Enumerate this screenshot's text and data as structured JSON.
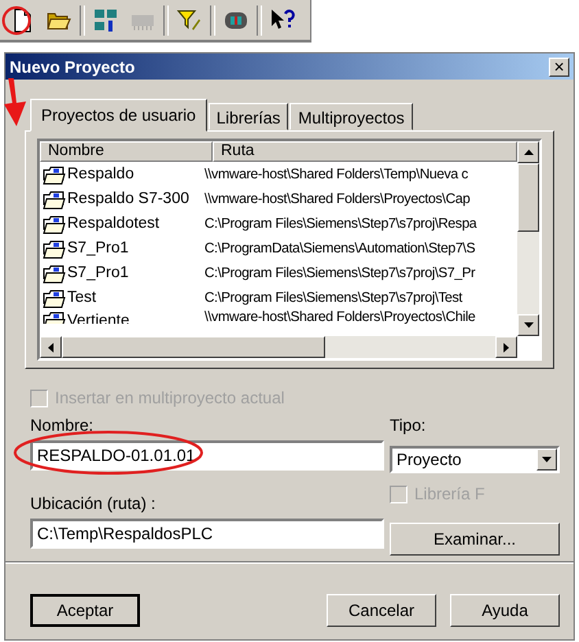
{
  "toolbar": [
    {
      "kind": "new-file",
      "disabled": false
    },
    {
      "kind": "open-folder",
      "disabled": false
    },
    {
      "kind": "network",
      "disabled": false
    },
    {
      "kind": "memory-card",
      "disabled": true
    },
    {
      "kind": "filter",
      "disabled": false
    },
    {
      "kind": "module",
      "disabled": false
    },
    {
      "kind": "help",
      "disabled": false
    }
  ],
  "window": {
    "title": "Nuevo Proyecto",
    "close": "×"
  },
  "tabs": [
    {
      "label": "Proyectos de usuario",
      "selected": true
    },
    {
      "label": "Librerías",
      "selected": false
    },
    {
      "label": "Multiproyectos",
      "selected": false
    }
  ],
  "table": {
    "columns": [
      "Nombre",
      "Ruta"
    ],
    "rows": [
      {
        "name": "Respaldo",
        "path": "\\\\vmware-host\\Shared Folders\\Temp\\Nueva c"
      },
      {
        "name": "Respaldo S7-300",
        "path": "\\\\vmware-host\\Shared Folders\\Proyectos\\Cap"
      },
      {
        "name": "Respaldotest",
        "path": "C:\\Program Files\\Siemens\\Step7\\s7proj\\Respa"
      },
      {
        "name": "S7_Pro1",
        "path": "C:\\ProgramData\\Siemens\\Automation\\Step7\\S"
      },
      {
        "name": "S7_Pro1",
        "path": "C:\\Program Files\\Siemens\\Step7\\s7proj\\S7_Pr"
      },
      {
        "name": "Test",
        "path": "C:\\Program Files\\Siemens\\Step7\\s7proj\\Test"
      },
      {
        "name": "Vertiente",
        "path": "\\\\vmware-host\\Shared Folders\\Proyectos\\Chile"
      }
    ]
  },
  "insert_multiproject": {
    "label": "Insertar en multiproyecto actual",
    "checked": false,
    "disabled": true
  },
  "name_field": {
    "label": "Nombre:",
    "value": "RESPALDO-01.01.01"
  },
  "type_field": {
    "label": "Tipo:",
    "value": "Proyecto"
  },
  "library_f": {
    "label": "Librería F",
    "checked": false,
    "disabled": true
  },
  "location_field": {
    "label": "Ubicación (ruta) :",
    "value": "C:\\Temp\\RespaldosPLC"
  },
  "browse_button": "Examinar...",
  "buttons": [
    {
      "label": "Aceptar",
      "default": true
    },
    {
      "label": "Cancelar",
      "default": false
    },
    {
      "label": "Ayuda",
      "default": false
    }
  ]
}
